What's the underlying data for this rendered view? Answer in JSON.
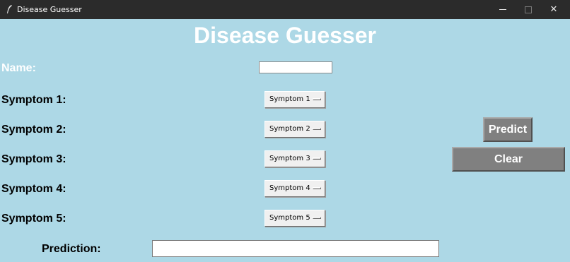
{
  "window": {
    "title": "Disease Guesser",
    "controls": {
      "minimize_icon": "minimize-icon",
      "maximize_icon": "maximize-icon",
      "close_icon": "close-icon",
      "close_glyph": "✕"
    }
  },
  "heading": "Disease Guesser",
  "name_field": {
    "label": "Name:",
    "value": ""
  },
  "symptoms": [
    {
      "label": "Symptom 1:",
      "selected": "Symptom 1"
    },
    {
      "label": "Symptom 2:",
      "selected": "Symptom 2"
    },
    {
      "label": "Symptom 3:",
      "selected": "Symptom 3"
    },
    {
      "label": "Symptom 4:",
      "selected": "Symptom 4"
    },
    {
      "label": "Symptom 5:",
      "selected": "Symptom 5"
    }
  ],
  "buttons": {
    "predict": "Predict",
    "clear": "Clear"
  },
  "prediction": {
    "label": "Prediction:",
    "value": ""
  },
  "colors": {
    "background": "#add8e6",
    "button": "#808080",
    "heading_text": "#ffffff",
    "titlebar": "#2b2b2b"
  }
}
